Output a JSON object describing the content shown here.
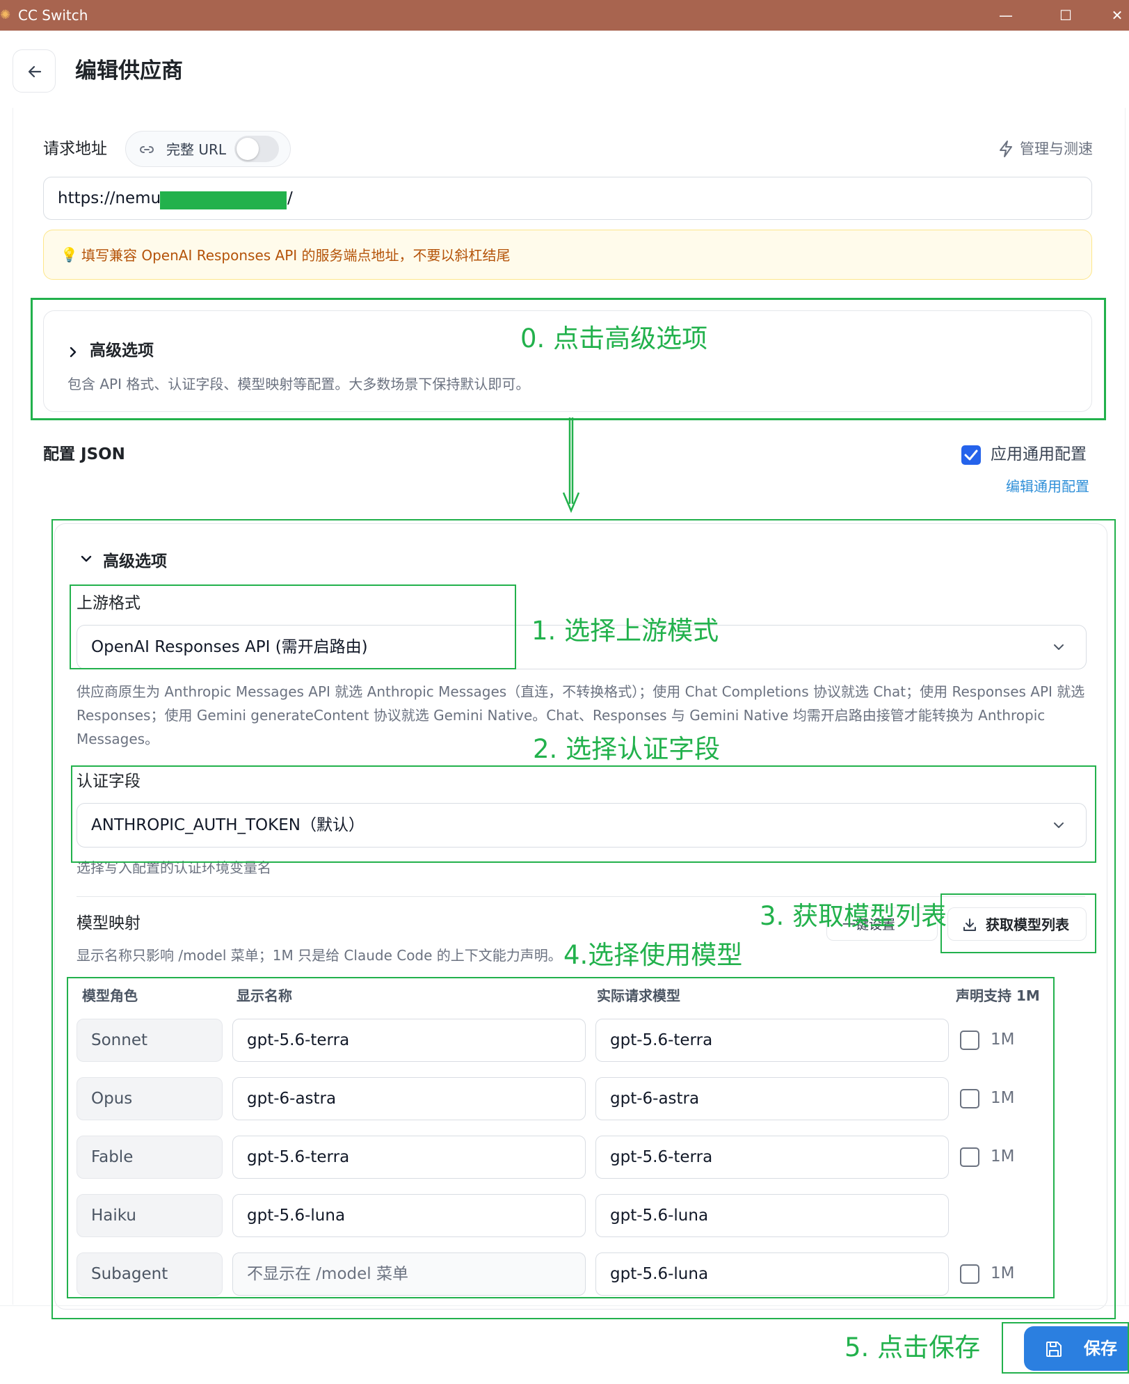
{
  "window": {
    "title": "CC Switch",
    "app_icon": "sun-icon",
    "controls": {
      "minimize": "—",
      "maximize": "☐",
      "close": "✕"
    }
  },
  "header": {
    "back_icon": "arrow-left-icon",
    "title": "编辑供应商"
  },
  "request_url": {
    "label": "请求地址",
    "full_url_label": "完整 URL",
    "full_url_enabled": false,
    "manage_label": "管理与测速",
    "url_prefix": "https://nemu.",
    "url_suffix": "/",
    "hint": "填写兼容 OpenAI Responses API 的服务端点地址，不要以斜杠结尾"
  },
  "advanced_collapsed": {
    "title": "高级选项",
    "description": "包含 API 格式、认证字段、模型映射等配置。大多数场景下保持默认即可。"
  },
  "config_json": {
    "label": "配置 JSON",
    "apply_common_label": "应用通用配置",
    "apply_common_checked": true,
    "edit_common_link": "编辑通用配置"
  },
  "advanced_expanded": {
    "title": "高级选项",
    "upstream": {
      "label": "上游格式",
      "value": "OpenAI Responses API (需开启路由)",
      "help_lines": [
        "供应商原生为 Anthropic Messages API 就选 Anthropic Messages（直连，不转换格式）；使用 Chat Completions 协议就选 Chat；使用 Responses API 就选",
        "Responses；使用 Gemini generateContent 协议就选 Gemini Native。Chat、Responses 与 Gemini Native 均需开启路由接管才能转换为 Anthropic",
        "Messages。"
      ]
    },
    "auth_field": {
      "label": "认证字段",
      "value": "ANTHROPIC_AUTH_TOKEN（默认）",
      "help": "选择写入配置的认证环境变量名"
    },
    "model_mapping": {
      "title": "模型映射",
      "quick_set_button": "一键设置",
      "fetch_button": "获取模型列表",
      "description": "显示名称只影响 /model 菜单；1M 只是给 Claude Code 的上下文能力声明。",
      "columns": [
        "模型角色",
        "显示名称",
        "实际请求模型",
        "声明支持 1M"
      ],
      "rows": [
        {
          "role": "Sonnet",
          "display": "gpt-5.6-terra",
          "display_placeholder": false,
          "model": "gpt-5.6-terra",
          "has_1m": true,
          "checked": false,
          "one_m": "1M"
        },
        {
          "role": "Opus",
          "display": "gpt-6-astra",
          "display_placeholder": false,
          "model": "gpt-6-astra",
          "has_1m": true,
          "checked": false,
          "one_m": "1M"
        },
        {
          "role": "Fable",
          "display": "gpt-5.6-terra",
          "display_placeholder": false,
          "model": "gpt-5.6-terra",
          "has_1m": true,
          "checked": false,
          "one_m": "1M"
        },
        {
          "role": "Haiku",
          "display": "gpt-5.6-luna",
          "display_placeholder": false,
          "model": "gpt-5.6-luna",
          "has_1m": false,
          "checked": false,
          "one_m": ""
        },
        {
          "role": "Subagent",
          "display": "不显示在 /model 菜单",
          "display_placeholder": true,
          "model": "gpt-5.6-luna",
          "has_1m": true,
          "checked": false,
          "one_m": "1M"
        }
      ]
    }
  },
  "footer": {
    "save_label": "保存",
    "save_icon": "floppy-disk-icon"
  },
  "annotations": {
    "step0": "0. 点击高级选项",
    "step1": "1. 选择上游模式",
    "step2": "2. 选择认证字段",
    "step3": "3. 获取模型列表",
    "step4": "4.选择使用模型",
    "step5": "5. 点击保存"
  },
  "colors": {
    "titlebar": "#a8644f",
    "accent_blue": "#2b7fe0",
    "annotation_green": "#22b14c",
    "hint_bg": "#fffbeb",
    "hint_text": "#b45309"
  }
}
